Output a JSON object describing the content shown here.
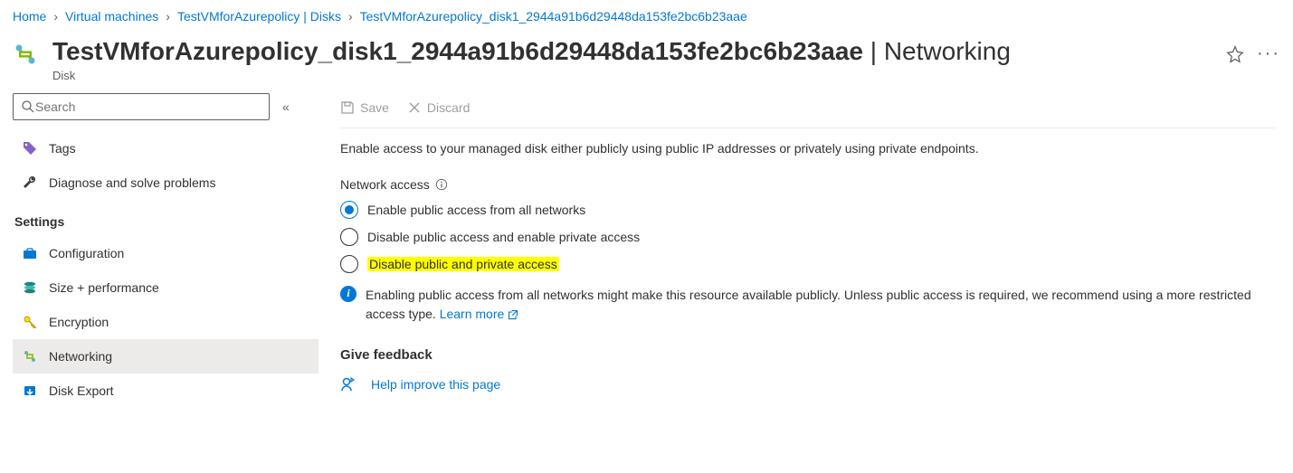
{
  "breadcrumb": [
    {
      "label": "Home"
    },
    {
      "label": "Virtual machines"
    },
    {
      "label": "TestVMforAzurepolicy | Disks"
    },
    {
      "label": "TestVMforAzurepolicy_disk1_2944a91b6d29448da153fe2bc6b23aae"
    }
  ],
  "header": {
    "title_main": "TestVMforAzurepolicy_disk1_2944a91b6d29448da153fe2bc6b23aae",
    "title_sub": " | Networking",
    "subtitle": "Disk"
  },
  "sidebar": {
    "search_placeholder": "Search",
    "items_top": [
      {
        "label": "Tags",
        "icon": "tag"
      },
      {
        "label": "Diagnose and solve problems",
        "icon": "wrench"
      }
    ],
    "group_title": "Settings",
    "items_settings": [
      {
        "label": "Configuration",
        "icon": "briefcase"
      },
      {
        "label": "Size + performance",
        "icon": "disks"
      },
      {
        "label": "Encryption",
        "icon": "key"
      },
      {
        "label": "Networking",
        "icon": "network",
        "selected": true
      },
      {
        "label": "Disk Export",
        "icon": "export"
      }
    ]
  },
  "toolbar": {
    "save_label": "Save",
    "discard_label": "Discard"
  },
  "content": {
    "description": "Enable access to your managed disk either publicly using public IP addresses or privately using private endpoints.",
    "field_label": "Network access",
    "options": [
      {
        "label": "Enable public access from all networks",
        "checked": true
      },
      {
        "label": "Disable public access and enable private access",
        "checked": false
      },
      {
        "label": "Disable public and private access",
        "checked": false,
        "highlighted": true
      }
    ],
    "info_text": "Enabling public access from all networks might make this resource available publicly. Unless public access is required, we recommend using a more restricted access type. ",
    "info_link": "Learn more",
    "feedback_title": "Give feedback",
    "feedback_link": "Help improve this page"
  }
}
